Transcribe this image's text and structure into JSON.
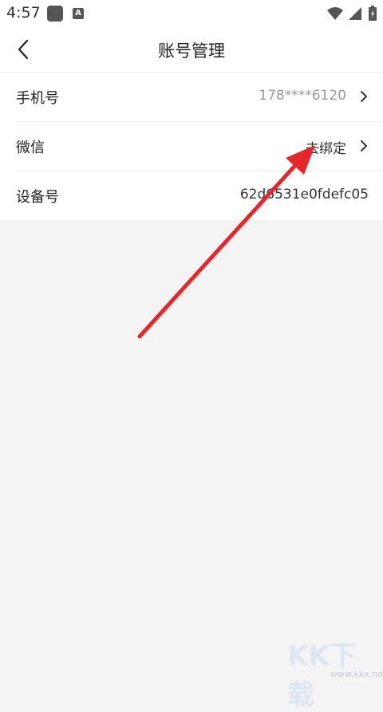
{
  "status_bar": {
    "time": "4:57",
    "icons": [
      "app-square-icon",
      "a-notification-icon",
      "wifi-icon",
      "signal-icon",
      "battery-icon"
    ]
  },
  "header": {
    "title": "账号管理",
    "back_icon": "chevron-left-icon"
  },
  "rows": [
    {
      "label": "手机号",
      "value": "178****6120",
      "has_arrow": true
    },
    {
      "label": "微信",
      "value": "去绑定",
      "has_arrow": true
    },
    {
      "label": "设备号",
      "value": "62d6531e0fdefc05",
      "has_arrow": false
    }
  ],
  "watermark": {
    "logo_text": "KK下载",
    "url": "www.kkx.net"
  },
  "colors": {
    "background": "#f4f4f4",
    "annotation_arrow": "#e8262a"
  }
}
